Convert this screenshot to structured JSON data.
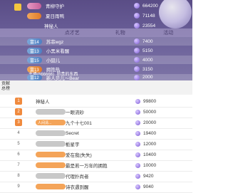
{
  "top_list": [
    {
      "level": "",
      "name": "青柳守护",
      "coins": "664200"
    },
    {
      "level": "",
      "name": "夏日雨鸭",
      "coins": "71148"
    },
    {
      "level": "",
      "name": "神秘人",
      "coins": "23554"
    },
    {
      "level": "富14",
      "name": "苏菲wgz",
      "coins": "7400"
    },
    {
      "level": "富13",
      "name": "小黑米看醒",
      "coins": "5150"
    },
    {
      "level": "富15",
      "name": "小囧儿",
      "coins": "4000"
    },
    {
      "level": "富13",
      "name": "拥抱热",
      "coins": "3150"
    },
    {
      "level": "富12",
      "name": "新人贝儿～Bear",
      "coins": "2000"
    }
  ],
  "top_tabs": [
    "",
    "点才艺",
    "礼物",
    "活动"
  ],
  "side_label": "总贡\n榜",
  "overlay_text": "主播(666666)",
  "overlay_text2": "昂贵的东西",
  "second_header": "贡献\n总榜",
  "ranked_list": [
    {
      "rank": "1",
      "badge": "",
      "name": "神秘人",
      "coins": "99800"
    },
    {
      "rank": "2",
      "badge": "",
      "name": "一眼流砂",
      "coins": "50000"
    },
    {
      "rank": "3",
      "badge": "人间清...",
      "name": "九个十七001",
      "coins": "20000"
    },
    {
      "rank": "4",
      "badge": "",
      "name": "Secret",
      "coins": "19400"
    },
    {
      "rank": "5",
      "badge": "",
      "name": "栀星宇",
      "coins": "12000"
    },
    {
      "rank": "6",
      "badge": "",
      "name": "爱在我(失失)",
      "coins": "10400"
    },
    {
      "rank": "7",
      "badge": "",
      "name": "最是若一万年的拥抱",
      "coins": "10000"
    },
    {
      "rank": "8",
      "badge": "",
      "name": "代理扑尚者",
      "coins": "9420"
    },
    {
      "rank": "9",
      "badge": "",
      "name": "诗衣遇到醒",
      "coins": "9040"
    }
  ],
  "colors": {
    "accent": "#7d5cd6",
    "rank_badge": "#f08a3e",
    "top_bg": "#5a4d86"
  }
}
